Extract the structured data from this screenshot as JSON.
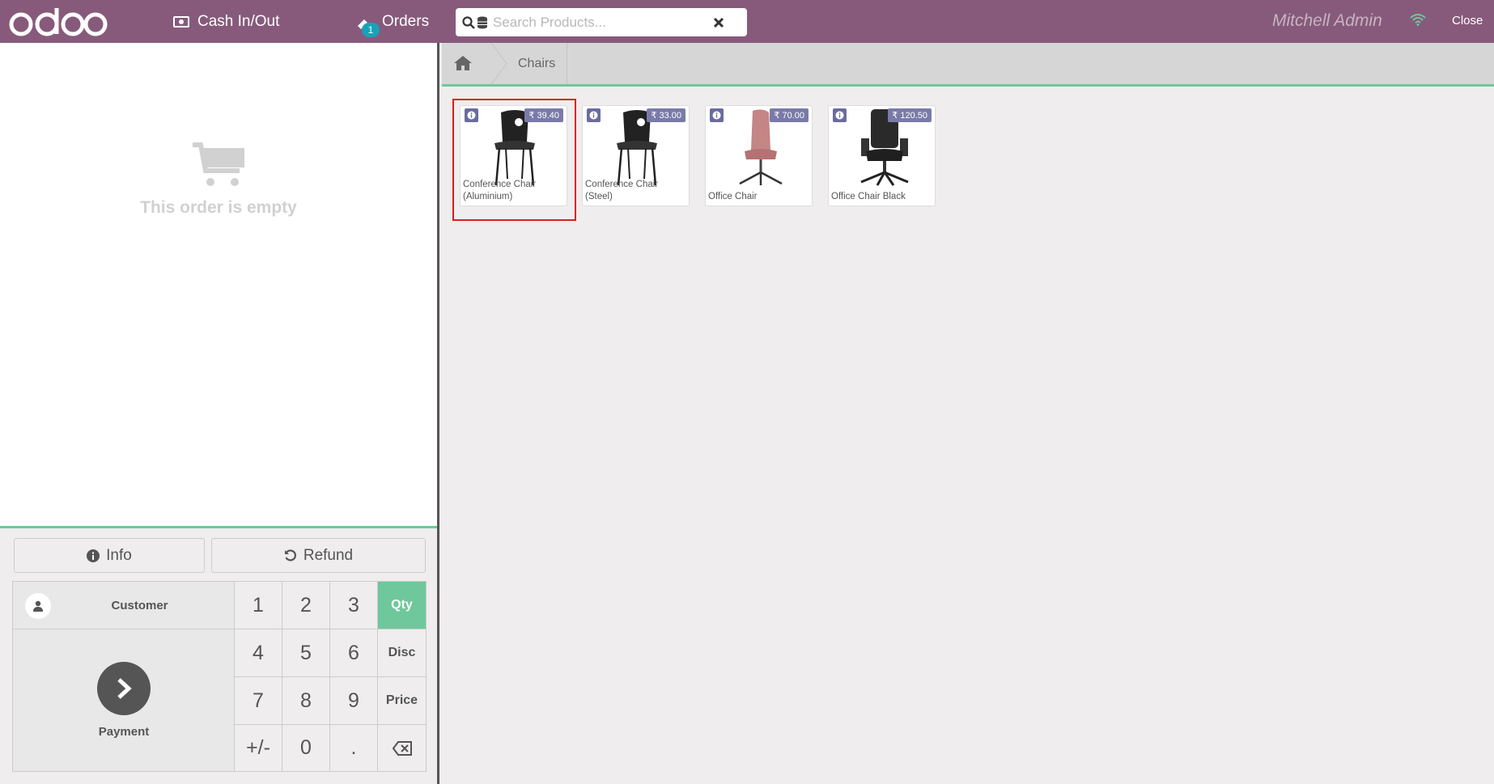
{
  "header": {
    "logo_text": "odoo",
    "cash_label": "Cash In/Out",
    "orders_label": "Orders",
    "orders_badge": "1",
    "search_placeholder": "Search Products...",
    "user_name": "Mitchell Admin",
    "close_label": "Close"
  },
  "order": {
    "empty_text": "This order is empty"
  },
  "controls": {
    "info_label": "Info",
    "refund_label": "Refund",
    "customer_label": "Customer",
    "payment_label": "Payment",
    "keys": [
      "1",
      "2",
      "3",
      "Qty",
      "4",
      "5",
      "6",
      "Disc",
      "7",
      "8",
      "9",
      "Price",
      "+/-",
      "0",
      "."
    ],
    "active_mode": "Qty"
  },
  "breadcrumb": {
    "category": "Chairs"
  },
  "products": [
    {
      "name": "Conference Chair (Aluminium)",
      "price": "₹ 39.40",
      "color": "#222222",
      "style": "stack"
    },
    {
      "name": "Conference Chair (Steel)",
      "price": "₹ 33.00",
      "color": "#222222",
      "style": "stack"
    },
    {
      "name": "Office Chair",
      "price": "₹ 70.00",
      "color": "#c48585",
      "style": "swivel"
    },
    {
      "name": "Office Chair Black",
      "price": "₹ 120.50",
      "color": "#2a2a2a",
      "style": "exec"
    }
  ],
  "colors": {
    "brand": "#875a7b",
    "accent": "#6ec89b",
    "price_badge": "#7a7aa8"
  }
}
